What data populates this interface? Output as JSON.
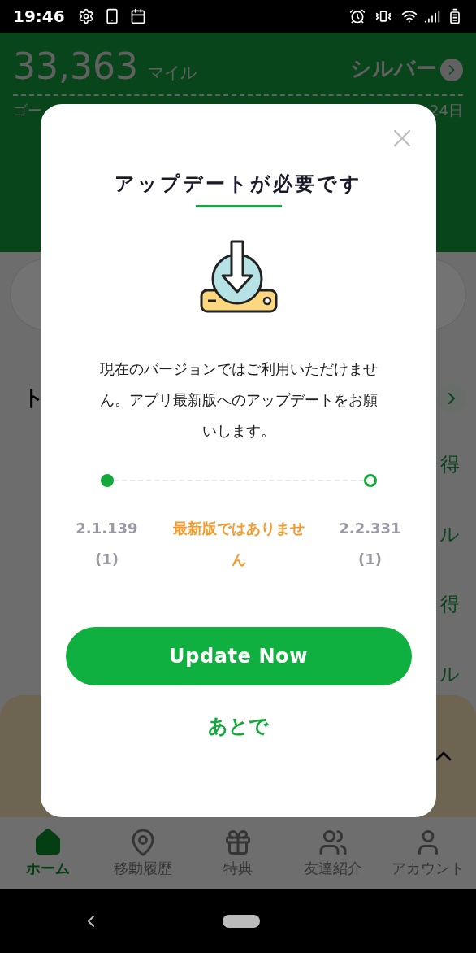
{
  "status_bar": {
    "time": "19:46"
  },
  "background": {
    "miles": "33,363",
    "miles_unit": "マイル",
    "rank": "シルバー",
    "rank_up_fragment": "ゴー",
    "days_left_fragment": "24日",
    "section_title_fragment": "ト",
    "row_fragments": [
      "得",
      "ル",
      "得",
      "ル"
    ]
  },
  "dialog": {
    "title": "アップデートが必要です",
    "message": "現在のバージョンではご利用いただけません。アプリ最新版へのアップデートをお願いします。",
    "progress": {
      "current_version": "2.1.139 (1)",
      "status": "最新版ではありません",
      "latest_version": "2.2.331 (1)",
      "current_reached": true,
      "latest_reached": false
    },
    "primary_button": "Update Now",
    "secondary_button": "あとで"
  },
  "tab_bar": [
    {
      "label": "ホーム",
      "kind": "home",
      "selected": true
    },
    {
      "label": "移動履歴",
      "kind": "route",
      "selected": false
    },
    {
      "label": "特典",
      "kind": "gift",
      "selected": false
    },
    {
      "label": "友達紹介",
      "kind": "friends",
      "selected": false
    },
    {
      "label": "アカウント",
      "kind": "account",
      "selected": false
    }
  ]
}
